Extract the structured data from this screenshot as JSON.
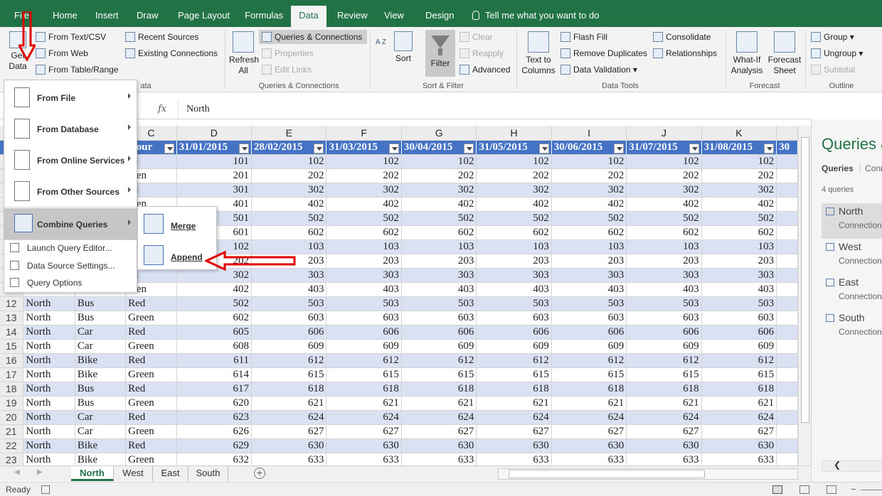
{
  "ribbon_tabs": [
    "File",
    "Home",
    "Insert",
    "Draw",
    "Page Layout",
    "Formulas",
    "Data",
    "Review",
    "View",
    "Design"
  ],
  "active_tab": "Data",
  "tell_me": "Tell me what you want to do",
  "ribbon": {
    "get_data": "Get Data",
    "from_text_csv": "From Text/CSV",
    "from_web": "From Web",
    "from_table_range": "From Table/Range",
    "recent_sources": "Recent Sources",
    "existing_connections": "Existing Connections",
    "group_get_transform": "ata",
    "refresh_all": "Refresh All",
    "queries_connections": "Queries & Connections",
    "properties": "Properties",
    "edit_links": "Edit Links",
    "group_queries": "Queries & Connections",
    "sort_az": "A Z",
    "sort": "Sort",
    "filter": "Filter",
    "clear": "Clear",
    "reapply": "Reapply",
    "advanced": "Advanced",
    "group_sort_filter": "Sort & Filter",
    "text_to_columns": "Text to Columns",
    "flash_fill": "Flash Fill",
    "remove_duplicates": "Remove Duplicates",
    "data_validation": "Data Validation",
    "consolidate": "Consolidate",
    "relationships": "Relationships",
    "group_data_tools": "Data Tools",
    "what_if": "What-If Analysis",
    "forecast_sheet": "Forecast Sheet",
    "group_forecast": "Forecast",
    "group": "Group",
    "ungroup": "Ungroup",
    "subtotal": "Subtotal",
    "group_outline": "Outline"
  },
  "formula_bar": {
    "fx": "fx",
    "value": "North"
  },
  "grid": {
    "col_letters": [
      "C",
      "D",
      "E",
      "F",
      "G",
      "H",
      "I",
      "J",
      "K"
    ],
    "header_row": [
      "olour",
      "31/01/2015",
      "28/02/2015",
      "31/03/2015",
      "30/04/2015",
      "31/05/2015",
      "30/06/2015",
      "31/07/2015",
      "31/08/2015",
      "30"
    ],
    "rows": [
      {
        "rn": "",
        "a": "",
        "b": "",
        "c": "ed",
        "v": [
          "101",
          "102",
          "102",
          "102",
          "102",
          "102",
          "102",
          "102"
        ]
      },
      {
        "rn": "",
        "a": "",
        "b": "",
        "c": "reen",
        "v": [
          "201",
          "202",
          "202",
          "202",
          "202",
          "202",
          "202",
          "202"
        ]
      },
      {
        "rn": "",
        "a": "",
        "b": "",
        "c": "ed",
        "v": [
          "301",
          "302",
          "302",
          "302",
          "302",
          "302",
          "302",
          "302"
        ]
      },
      {
        "rn": "",
        "a": "",
        "b": "",
        "c": "reen",
        "v": [
          "401",
          "402",
          "402",
          "402",
          "402",
          "402",
          "402",
          "402"
        ]
      },
      {
        "rn": "",
        "a": "",
        "b": "",
        "c": "",
        "v": [
          "501",
          "502",
          "502",
          "502",
          "502",
          "502",
          "502",
          "502"
        ]
      },
      {
        "rn": "",
        "a": "",
        "b": "",
        "c": "",
        "v": [
          "601",
          "602",
          "602",
          "602",
          "602",
          "602",
          "602",
          "602"
        ]
      },
      {
        "rn": "",
        "a": "",
        "b": "",
        "c": "",
        "v": [
          "102",
          "103",
          "103",
          "103",
          "103",
          "103",
          "103",
          "103"
        ]
      },
      {
        "rn": "",
        "a": "",
        "b": "",
        "c": "",
        "v": [
          "202",
          "203",
          "203",
          "203",
          "203",
          "203",
          "203",
          "203"
        ]
      },
      {
        "rn": "",
        "a": "",
        "b": "",
        "c": "ed",
        "v": [
          "302",
          "303",
          "303",
          "303",
          "303",
          "303",
          "303",
          "303"
        ]
      },
      {
        "rn": "",
        "a": "",
        "b": "",
        "c": "reen",
        "v": [
          "402",
          "403",
          "403",
          "403",
          "403",
          "403",
          "403",
          "403"
        ]
      },
      {
        "rn": "12",
        "a": "North",
        "b": "Bus",
        "c": "Red",
        "v": [
          "502",
          "503",
          "503",
          "503",
          "503",
          "503",
          "503",
          "503"
        ]
      },
      {
        "rn": "13",
        "a": "North",
        "b": "Bus",
        "c": "Green",
        "v": [
          "602",
          "603",
          "603",
          "603",
          "603",
          "603",
          "603",
          "603"
        ]
      },
      {
        "rn": "14",
        "a": "North",
        "b": "Car",
        "c": "Red",
        "v": [
          "605",
          "606",
          "606",
          "606",
          "606",
          "606",
          "606",
          "606"
        ]
      },
      {
        "rn": "15",
        "a": "North",
        "b": "Car",
        "c": "Green",
        "v": [
          "608",
          "609",
          "609",
          "609",
          "609",
          "609",
          "609",
          "609"
        ]
      },
      {
        "rn": "16",
        "a": "North",
        "b": "Bike",
        "c": "Red",
        "v": [
          "611",
          "612",
          "612",
          "612",
          "612",
          "612",
          "612",
          "612"
        ]
      },
      {
        "rn": "17",
        "a": "North",
        "b": "Bike",
        "c": "Green",
        "v": [
          "614",
          "615",
          "615",
          "615",
          "615",
          "615",
          "615",
          "615"
        ]
      },
      {
        "rn": "18",
        "a": "North",
        "b": "Bus",
        "c": "Red",
        "v": [
          "617",
          "618",
          "618",
          "618",
          "618",
          "618",
          "618",
          "618"
        ]
      },
      {
        "rn": "19",
        "a": "North",
        "b": "Bus",
        "c": "Green",
        "v": [
          "620",
          "621",
          "621",
          "621",
          "621",
          "621",
          "621",
          "621"
        ]
      },
      {
        "rn": "20",
        "a": "North",
        "b": "Car",
        "c": "Red",
        "v": [
          "623",
          "624",
          "624",
          "624",
          "624",
          "624",
          "624",
          "624"
        ]
      },
      {
        "rn": "21",
        "a": "North",
        "b": "Car",
        "c": "Green",
        "v": [
          "626",
          "627",
          "627",
          "627",
          "627",
          "627",
          "627",
          "627"
        ]
      },
      {
        "rn": "22",
        "a": "North",
        "b": "Bike",
        "c": "Red",
        "v": [
          "629",
          "630",
          "630",
          "630",
          "630",
          "630",
          "630",
          "630"
        ]
      },
      {
        "rn": "23",
        "a": "North",
        "b": "Bike",
        "c": "Green",
        "v": [
          "632",
          "633",
          "633",
          "633",
          "633",
          "633",
          "633",
          "633"
        ]
      }
    ]
  },
  "get_data_menu": {
    "items": [
      "From File",
      "From Database",
      "From Online Services",
      "From Other Sources",
      "Combine Queries"
    ],
    "small_items": [
      "Launch Query Editor...",
      "Data Source Settings...",
      "Query Options"
    ]
  },
  "combine_submenu": [
    "Merge",
    "Append"
  ],
  "sheet_tabs": [
    "North",
    "West",
    "East",
    "South"
  ],
  "active_sheet": "North",
  "status": "Ready",
  "queries_pane": {
    "title": "Queries &",
    "tab_queries": "Queries",
    "tab_connections": "Conn",
    "count": "4 queries",
    "items": [
      {
        "name": "North",
        "sub": "Connection"
      },
      {
        "name": "West",
        "sub": "Connection"
      },
      {
        "name": "East",
        "sub": "Connection"
      },
      {
        "name": "South",
        "sub": "Connection"
      }
    ]
  },
  "colors": {
    "excel_green": "#217346",
    "table_header": "#4472c4",
    "band": "#d9e1f2",
    "annotation_red": "#e00000"
  }
}
